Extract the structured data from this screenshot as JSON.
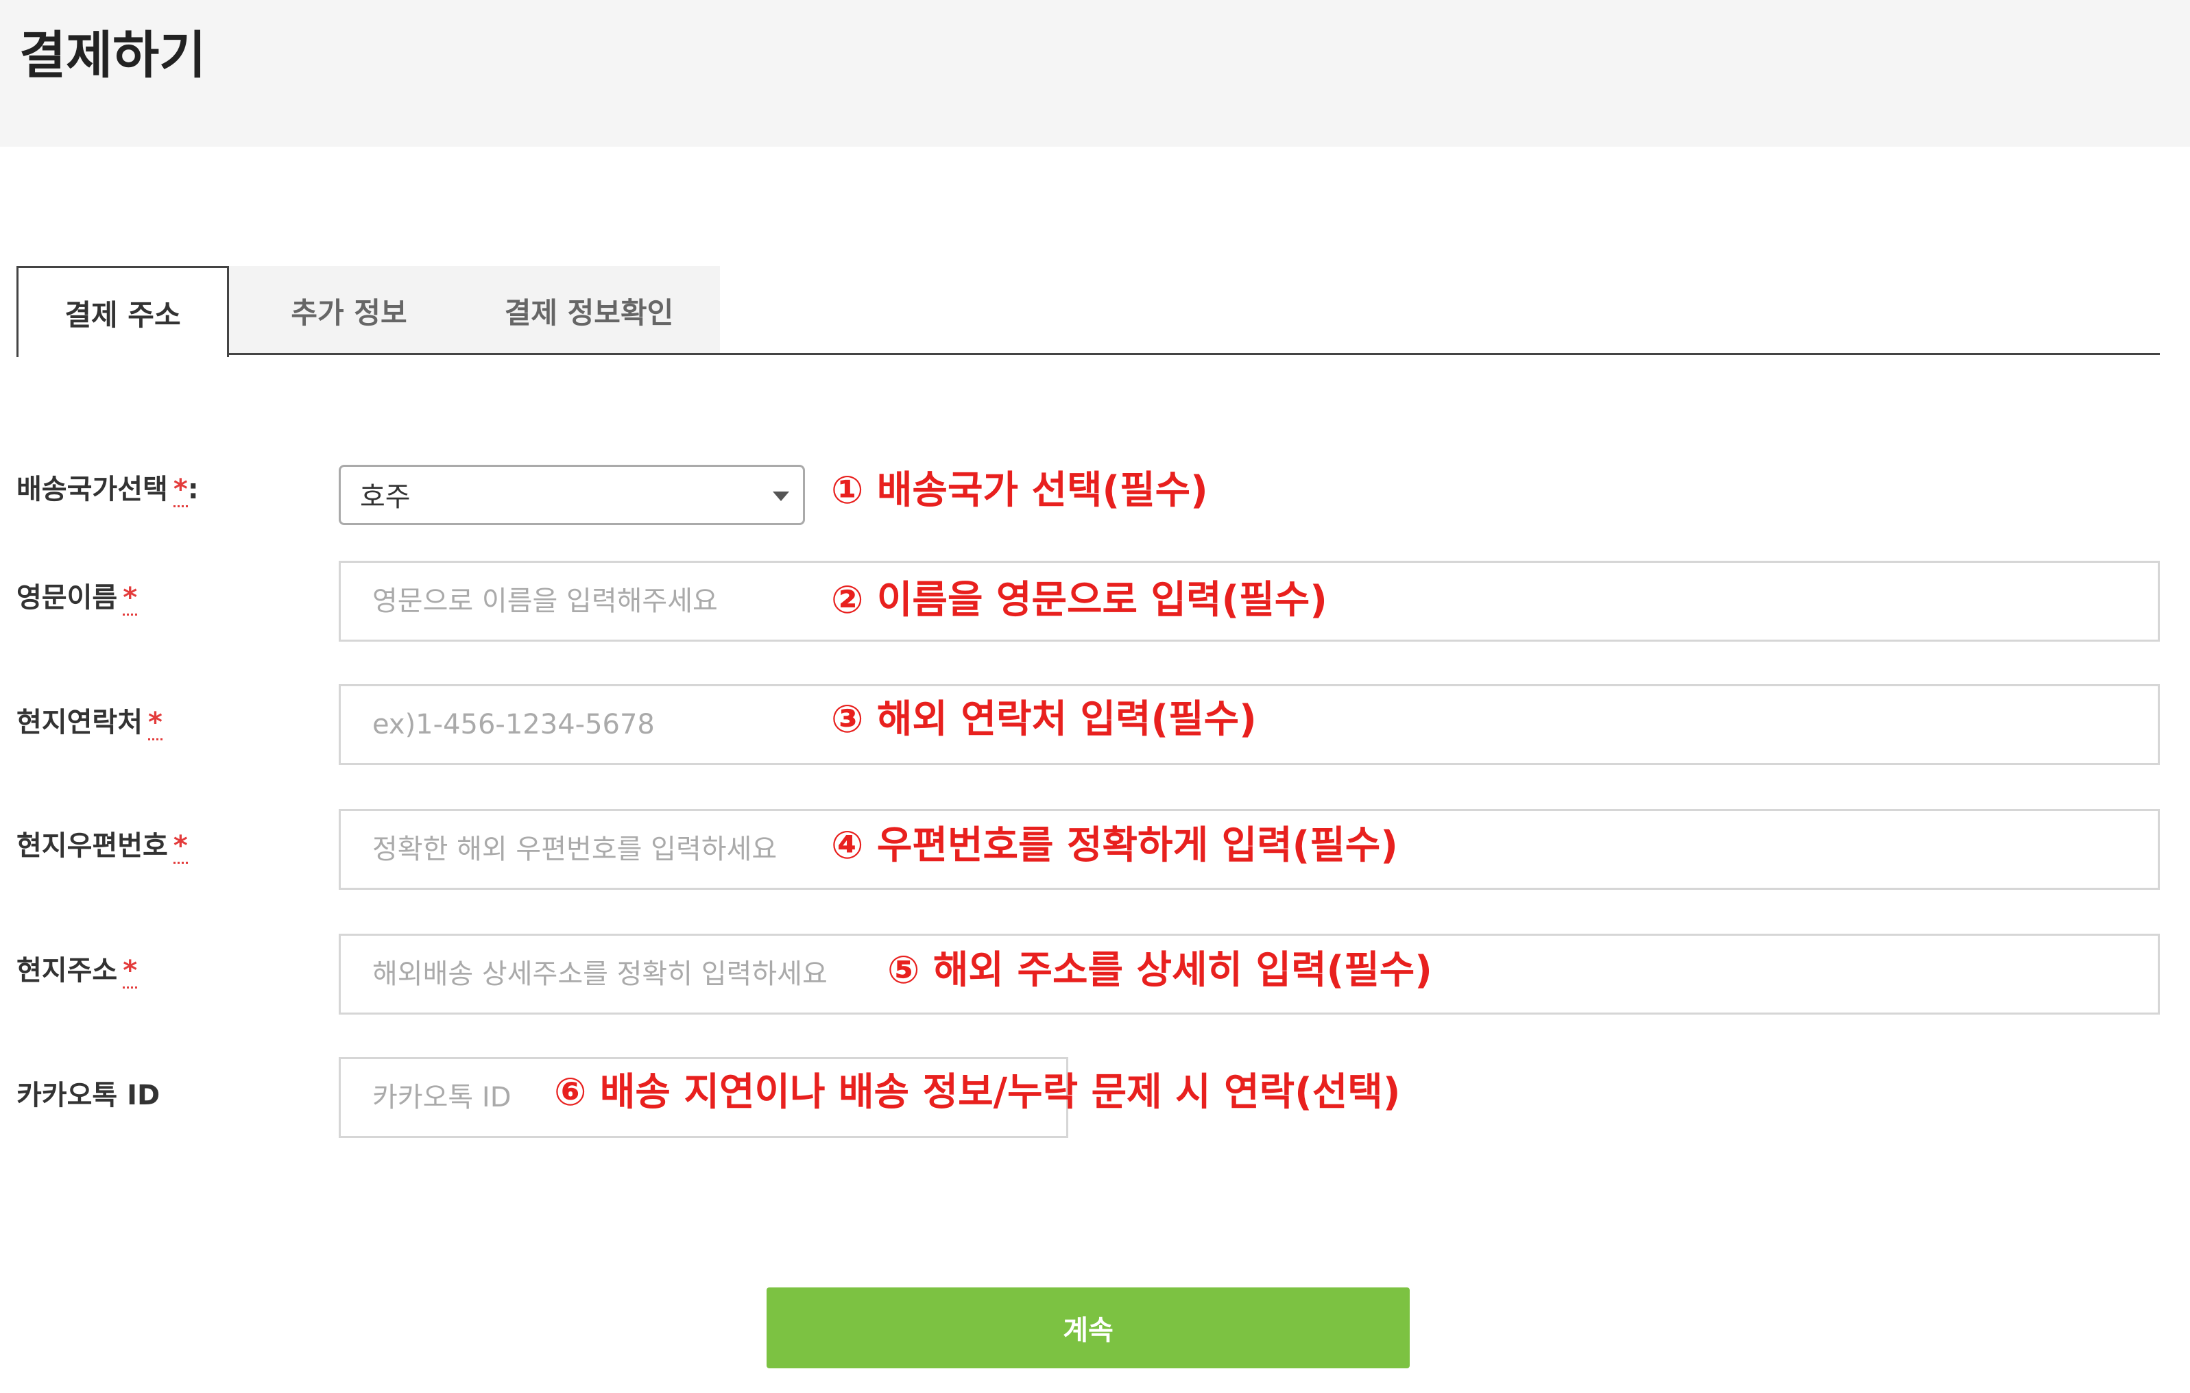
{
  "header": {
    "title": "결제하기"
  },
  "tabs": [
    {
      "label": "결제 주소"
    },
    {
      "label": "추가 정보"
    },
    {
      "label": "결제 정보확인"
    }
  ],
  "form": {
    "required_mark": "*",
    "country": {
      "label": "배송국가선택",
      "label_suffix": ":",
      "value": "호주",
      "note": "① 배송국가 선택(필수)"
    },
    "english_name": {
      "label": "영문이름",
      "placeholder": "영문으로 이름을 입력해주세요",
      "note": "② 이름을 영문으로 입력(필수)"
    },
    "phone": {
      "label": "현지연락처",
      "placeholder": "ex)1-456-1234-5678",
      "note": "③ 해외 연락처 입력(필수)"
    },
    "postal_code": {
      "label": "현지우편번호",
      "placeholder": "정확한 해외 우편번호를 입력하세요",
      "note": "④ 우편번호를 정확하게 입력(필수)"
    },
    "address": {
      "label": "현지주소",
      "placeholder": "해외배송 상세주소를 정확히 입력하세요",
      "note": "⑤ 해외 주소를 상세히 입력(필수)"
    },
    "kakao": {
      "label": "카카오톡 ID",
      "placeholder": "카카오톡 ID",
      "note": "⑥ 배송 지연이나 배송 정보/누락 문제 시 연락(선택)"
    }
  },
  "continue_button": {
    "label": "계속"
  },
  "colors": {
    "accent_green": "#7cc242",
    "annotation_red": "#e8201e",
    "required_red": "#e33b3b"
  }
}
